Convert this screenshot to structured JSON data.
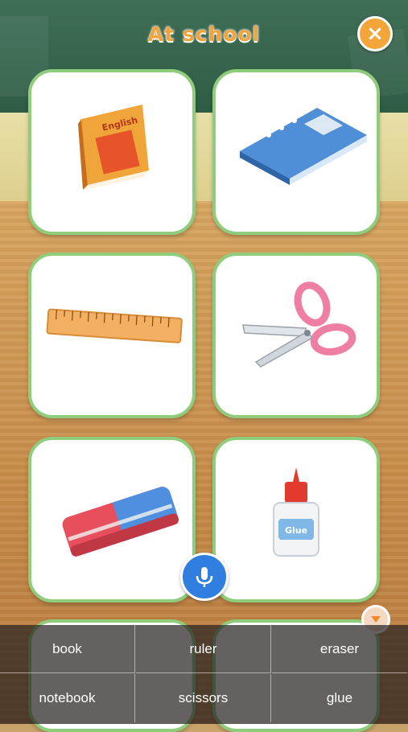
{
  "screen": {
    "title": "At school"
  },
  "header": {
    "close_icon": "close-icon"
  },
  "cards": [
    {
      "id": "card-book",
      "icon": "book-icon",
      "text": "English"
    },
    {
      "id": "card-notebook",
      "icon": "notebook-icon"
    },
    {
      "id": "card-ruler",
      "icon": "ruler-icon"
    },
    {
      "id": "card-scissors",
      "icon": "scissors-icon"
    },
    {
      "id": "card-eraser",
      "icon": "eraser-icon"
    },
    {
      "id": "card-glue",
      "icon": "glue-icon",
      "text": "Glue"
    }
  ],
  "controls": {
    "mic_icon": "microphone-icon",
    "toggle_icon": "chevron-down-icon"
  },
  "word_bank": {
    "row1": [
      "book",
      "ruler",
      "eraser"
    ],
    "row2": [
      "notebook",
      "scissors",
      "glue"
    ]
  },
  "colors": {
    "title": "#f4a23a",
    "card_border": "#8fcc7c",
    "mic": "#2f7ee0",
    "close": "#f3a53a"
  }
}
